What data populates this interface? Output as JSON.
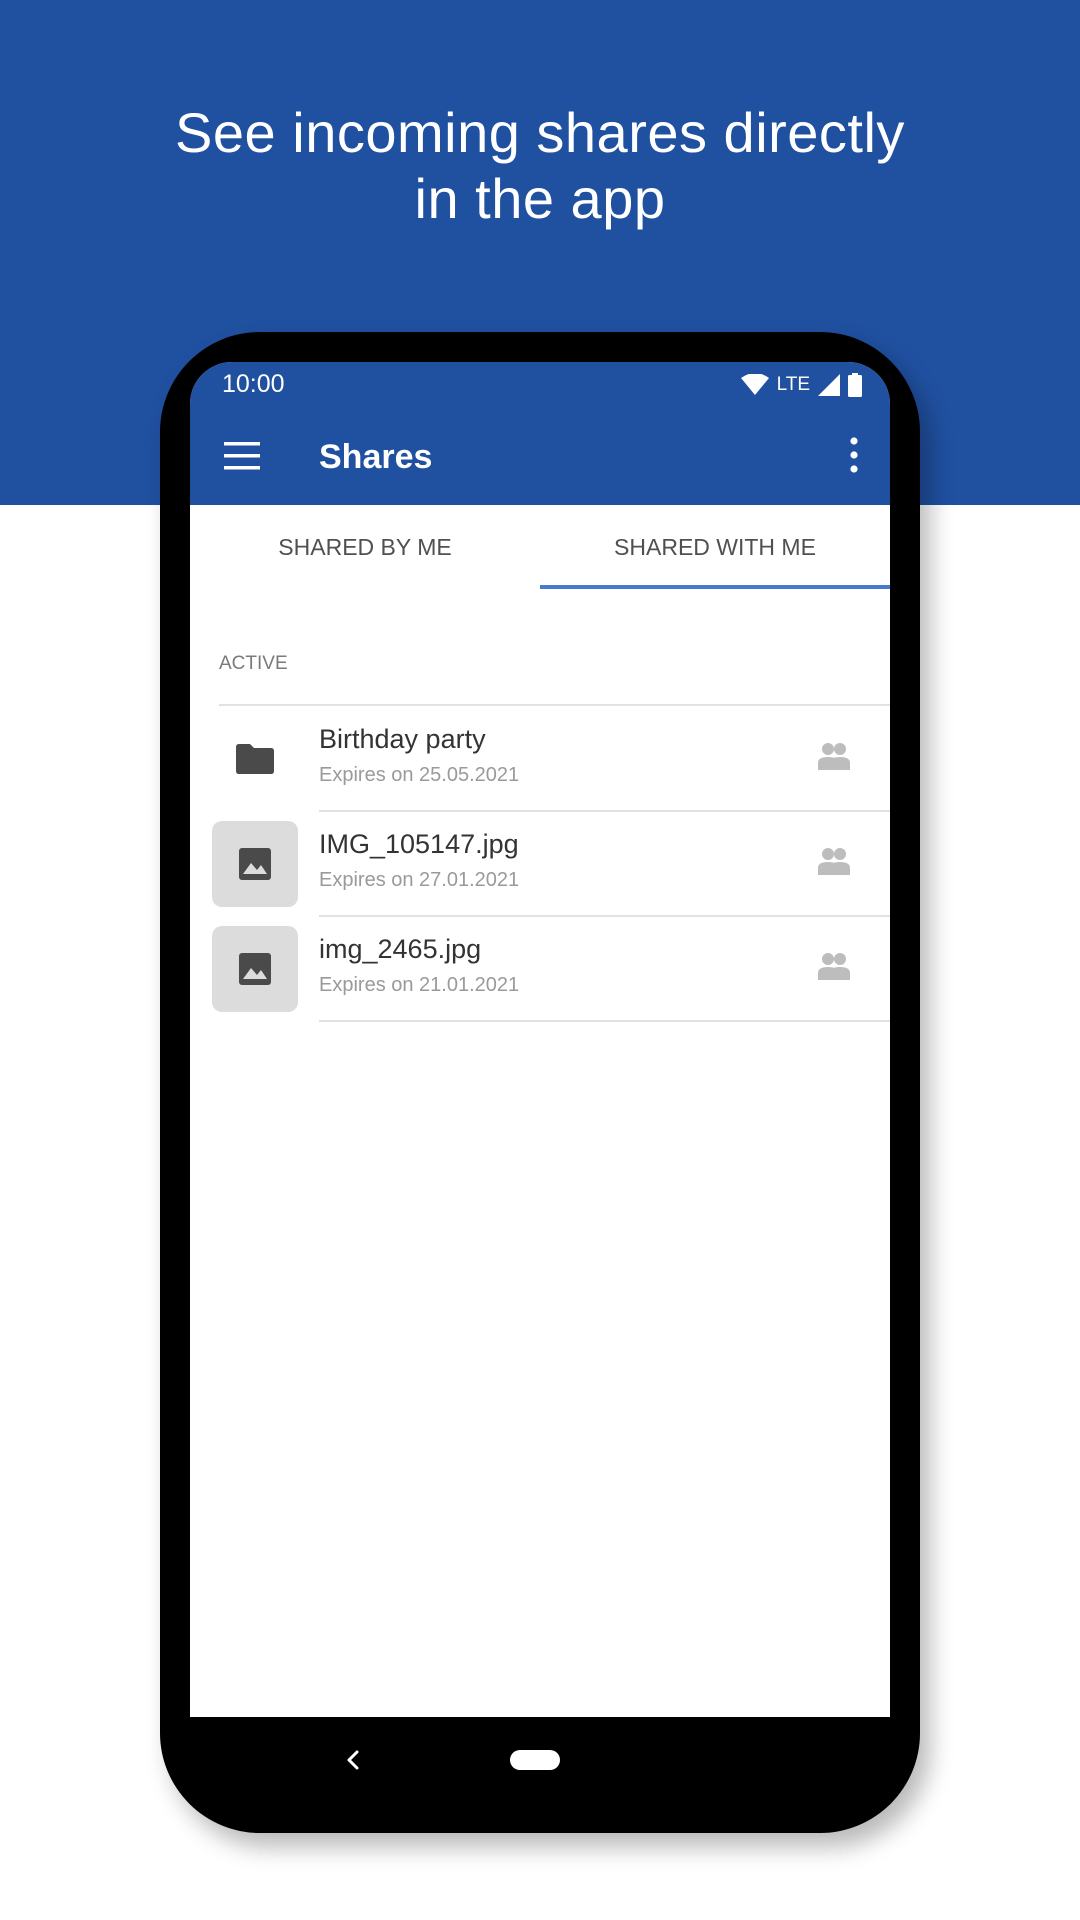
{
  "promo": {
    "headline_line1": "See incoming shares directly",
    "headline_line2": "in the app",
    "background_color": "#2050a0"
  },
  "status_bar": {
    "time": "10:00",
    "network": "LTE",
    "icons": [
      "wifi-icon",
      "signal-icon",
      "battery-icon"
    ]
  },
  "app_bar": {
    "title": "Shares",
    "menu_icon": "menu-icon",
    "overflow_icon": "more-vert-icon"
  },
  "tabs": [
    {
      "label": "SHARED BY ME",
      "selected": false
    },
    {
      "label": "SHARED WITH ME",
      "selected": true
    }
  ],
  "section": {
    "label": "ACTIVE"
  },
  "shares": [
    {
      "name": "Birthday party",
      "expires": "Expires on 25.05.2021",
      "type_icon": "folder-icon",
      "share_icon": "group-icon"
    },
    {
      "name": "IMG_105147.jpg",
      "expires": "Expires on 27.01.2021",
      "type_icon": "image-icon",
      "share_icon": "group-icon"
    },
    {
      "name": "img_2465.jpg",
      "expires": "Expires on 21.01.2021",
      "type_icon": "image-icon",
      "share_icon": "group-icon"
    }
  ],
  "nav_bar": {
    "back_icon": "back-icon",
    "home_icon": "home-pill-icon"
  },
  "colors": {
    "accent": "#2050a0",
    "tab_indicator": "#4a7ad0"
  }
}
